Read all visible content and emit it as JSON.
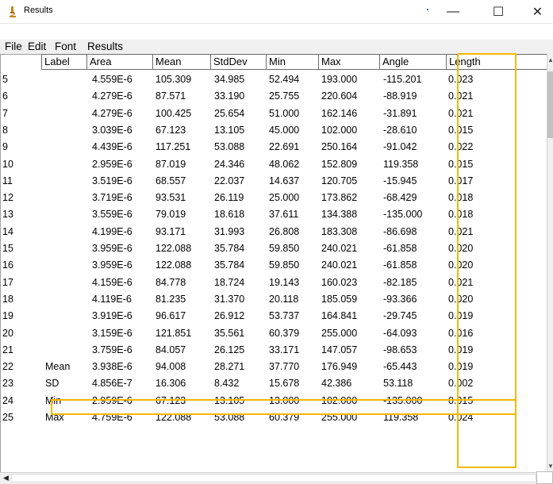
{
  "window": {
    "title": "Results",
    "minimize_glyph": "—",
    "maximize_glyph": "☐",
    "close_glyph": "✕"
  },
  "menu": {
    "file": "File",
    "edit": "Edit",
    "font": "Font",
    "results": "Results"
  },
  "table": {
    "columns": [
      "Label",
      "Area",
      "Mean",
      "StdDev",
      "Min",
      "Max",
      "Angle",
      "Length"
    ],
    "rows": [
      {
        "n": "5",
        "label": "",
        "area": "4.559E-6",
        "mean": "105.309",
        "stddev": "34.985",
        "min": "52.494",
        "max": "193.000",
        "angle": "-115.201",
        "length": "0.023"
      },
      {
        "n": "6",
        "label": "",
        "area": "4.279E-6",
        "mean": "87.571",
        "stddev": "33.190",
        "min": "25.755",
        "max": "220.604",
        "angle": "-88.919",
        "length": "0.021"
      },
      {
        "n": "7",
        "label": "",
        "area": "4.279E-6",
        "mean": "100.425",
        "stddev": "25.654",
        "min": "51.000",
        "max": "162.146",
        "angle": "-31.891",
        "length": "0.021"
      },
      {
        "n": "8",
        "label": "",
        "area": "3.039E-6",
        "mean": "67.123",
        "stddev": "13.105",
        "min": "45.000",
        "max": "102.000",
        "angle": "-28.610",
        "length": "0.015"
      },
      {
        "n": "9",
        "label": "",
        "area": "4.439E-6",
        "mean": "117.251",
        "stddev": "53.088",
        "min": "22.691",
        "max": "250.164",
        "angle": "-91.042",
        "length": "0.022"
      },
      {
        "n": "10",
        "label": "",
        "area": "2.959E-6",
        "mean": "87.019",
        "stddev": "24.346",
        "min": "48.062",
        "max": "152.809",
        "angle": "119.358",
        "length": "0.015"
      },
      {
        "n": "11",
        "label": "",
        "area": "3.519E-6",
        "mean": "68.557",
        "stddev": "22.037",
        "min": "14.637",
        "max": "120.705",
        "angle": "-15.945",
        "length": "0.017"
      },
      {
        "n": "12",
        "label": "",
        "area": "3.719E-6",
        "mean": "93.531",
        "stddev": "26.119",
        "min": "25.000",
        "max": "173.862",
        "angle": "-68.429",
        "length": "0.018"
      },
      {
        "n": "13",
        "label": "",
        "area": "3.559E-6",
        "mean": "79.019",
        "stddev": "18.618",
        "min": "37.611",
        "max": "134.388",
        "angle": "-135.000",
        "length": "0.018"
      },
      {
        "n": "14",
        "label": "",
        "area": "4.199E-6",
        "mean": "93.171",
        "stddev": "31.993",
        "min": "26.808",
        "max": "183.308",
        "angle": "-86.698",
        "length": "0.021"
      },
      {
        "n": "15",
        "label": "",
        "area": "3.959E-6",
        "mean": "122.088",
        "stddev": "35.784",
        "min": "59.850",
        "max": "240.021",
        "angle": "-61.858",
        "length": "0.020"
      },
      {
        "n": "16",
        "label": "",
        "area": "3.959E-6",
        "mean": "122.088",
        "stddev": "35.784",
        "min": "59.850",
        "max": "240.021",
        "angle": "-61.858",
        "length": "0.020"
      },
      {
        "n": "17",
        "label": "",
        "area": "4.159E-6",
        "mean": "84.778",
        "stddev": "18.724",
        "min": "19.143",
        "max": "160.023",
        "angle": "-82.185",
        "length": "0.021"
      },
      {
        "n": "18",
        "label": "",
        "area": "4.119E-6",
        "mean": "81.235",
        "stddev": "31.370",
        "min": "20.118",
        "max": "185.059",
        "angle": "-93.366",
        "length": "0.020"
      },
      {
        "n": "19",
        "label": "",
        "area": "3.919E-6",
        "mean": "96.617",
        "stddev": "26.912",
        "min": "53.737",
        "max": "164.841",
        "angle": "-29.745",
        "length": "0.019"
      },
      {
        "n": "20",
        "label": "",
        "area": "3.159E-6",
        "mean": "121.851",
        "stddev": "35.561",
        "min": "60.379",
        "max": "255.000",
        "angle": "-64.093",
        "length": "0.016"
      },
      {
        "n": "21",
        "label": "",
        "area": "3.759E-6",
        "mean": "84.057",
        "stddev": "26.125",
        "min": "33.171",
        "max": "147.057",
        "angle": "-98.653",
        "length": "0.019"
      },
      {
        "n": "22",
        "label": "Mean",
        "area": "3.938E-6",
        "mean": "94.008",
        "stddev": "28.271",
        "min": "37.770",
        "max": "176.949",
        "angle": "-65.443",
        "length": "0.019"
      },
      {
        "n": "23",
        "label": "SD",
        "area": "4.856E-7",
        "mean": "16.306",
        "stddev": "8.432",
        "min": "15.678",
        "max": "42.386",
        "angle": "53.118",
        "length": "0.002"
      },
      {
        "n": "24",
        "label": "Min",
        "area": "2.959E-6",
        "mean": "67.123",
        "stddev": "13.105",
        "min": "13.000",
        "max": "102.000",
        "angle": "-135.000",
        "length": "0.015"
      },
      {
        "n": "25",
        "label": "Max",
        "area": "4.759E-6",
        "mean": "122.088",
        "stddev": "53.088",
        "min": "60.379",
        "max": "255.000",
        "angle": "119.358",
        "length": "0.024"
      }
    ]
  },
  "highlight": {
    "color": "#f5b800",
    "column": "Length",
    "row": "Mean"
  },
  "icons": {
    "app": "microscope-icon",
    "scroll_left": "scroll-left-arrow-icon",
    "scroll_up": "scroll-up-arrow-icon",
    "scroll_down": "scroll-down-arrow-icon"
  }
}
